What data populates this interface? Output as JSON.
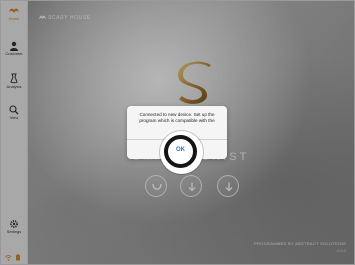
{
  "sidebar": {
    "items": [
      {
        "label": "Home",
        "icon": "home-icon",
        "active": true
      },
      {
        "label": "Customer",
        "icon": "customer-icon",
        "active": false
      },
      {
        "label": "Analysis",
        "icon": "analysis-icon",
        "active": false
      },
      {
        "label": "View",
        "icon": "search-icon",
        "active": false
      }
    ],
    "settings": {
      "label": "Settings",
      "icon": "gear-icon"
    },
    "status_icons": [
      "wifi-icon",
      "battery-icon"
    ]
  },
  "main": {
    "brand": "SCARY HOUSE",
    "title": "SMART TUNIST",
    "powered_by": "PROGRAMMED BY ABSTRACT SOLUTIONS",
    "version": "v1.0.1",
    "action_buttons": [
      "connect-icon",
      "download-icon",
      "share-icon"
    ]
  },
  "dialog": {
    "message": "Connected to new device. Set up the program which is compatible with the",
    "ok_label": "OK"
  },
  "colors": {
    "accent": "#c98a2a",
    "ok_text": "#2f74c0",
    "highlight_ring": "#151515"
  }
}
